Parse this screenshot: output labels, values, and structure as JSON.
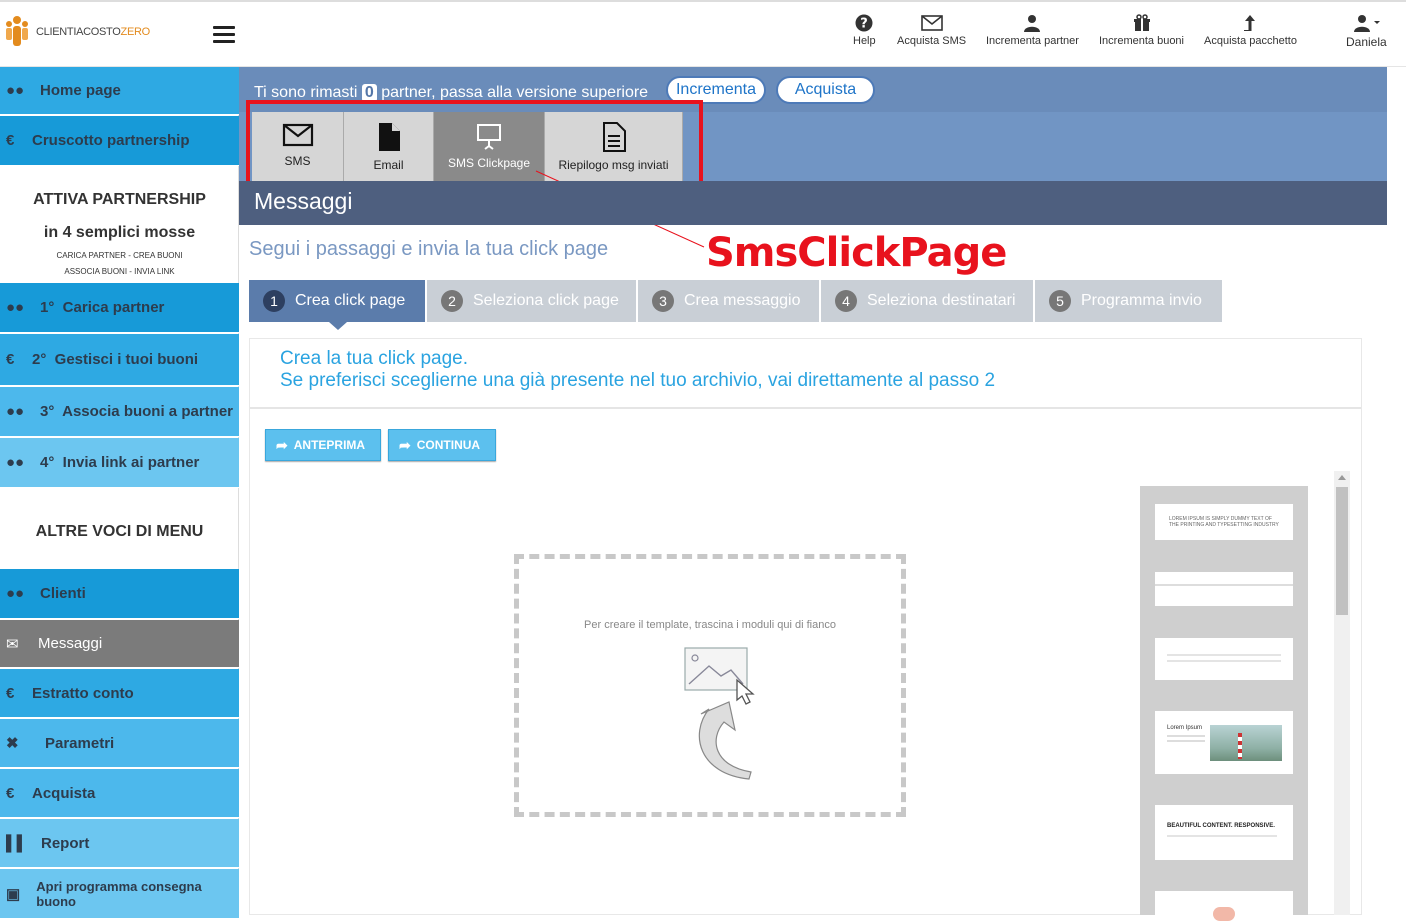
{
  "brand": {
    "part1": "CLIENTIACOSTO",
    "part2": "ZERO"
  },
  "topnav": [
    {
      "label": "Help",
      "icon": "help-icon"
    },
    {
      "label": "Acquista SMS",
      "icon": "envelope-icon"
    },
    {
      "label": "Incrementa partner",
      "icon": "user-icon"
    },
    {
      "label": "Incrementa buoni",
      "icon": "gift-icon"
    },
    {
      "label": "Acquista pacchetto",
      "icon": "arrow-up-icon"
    },
    {
      "label": "Daniela",
      "icon": "user-dropdown-icon"
    }
  ],
  "sidebar": {
    "home": "Home page",
    "cruscotto": "Cruscotto partnership",
    "attiva_title": "ATTIVA PARTNERSHIP",
    "attiva_sub": "in 4 semplici mosse",
    "attiva_line1": "CARICA PARTNER - CREA BUONI",
    "attiva_line2": "ASSOCIA BUONI - INVIA LINK",
    "step1": "1°  Carica partner",
    "step2": "2°  Gestisci i tuoi buoni",
    "step3": "3°  Associa buoni a partner",
    "step4": "4°  Invia link ai partner",
    "altre_title": "ALTRE VOCI DI MENU",
    "clienti": "Clienti",
    "messaggi": "Messaggi",
    "estratto": "Estratto conto",
    "parametri": "Parametri",
    "acquista": "Acquista",
    "report": "Report",
    "apri": "Apri programma consegna buono",
    "euro": "€"
  },
  "notice": {
    "before": "Ti sono rimasti",
    "count": "0",
    "after": "partner, passa alla versione superiore"
  },
  "notice_buttons": {
    "incrementa": "Incrementa",
    "acquista": "Acquista"
  },
  "message_tabs": [
    {
      "label": "SMS"
    },
    {
      "label": "Email"
    },
    {
      "label": "SMS Clickpage"
    },
    {
      "label": "Riepilogo msg inviati"
    }
  ],
  "section_title": "Messaggi",
  "annotation": "SmsClickPage",
  "subtitle": "Segui i passaggi e invia la tua click page",
  "steps": [
    {
      "num": "1",
      "label": "Crea click page"
    },
    {
      "num": "2",
      "label": "Seleziona click page"
    },
    {
      "num": "3",
      "label": "Crea messaggio"
    },
    {
      "num": "4",
      "label": "Seleziona destinatari"
    },
    {
      "num": "5",
      "label": "Programma invio"
    }
  ],
  "intro": {
    "line1": "Crea la tua click page.",
    "line2": "Se preferisci sceglierne una già presente nel tuo archivio, vai direttamente al passo 2"
  },
  "actions": {
    "preview": "ANTEPRIMA",
    "continue": "CONTINUA"
  },
  "dropzone_text": "Per creare il template, trascina i moduli qui di fianco",
  "modules": {
    "m1": "LOREM IPSUM IS SIMPLY DUMMY TEXT OF THE PRINTING AND TYPESETTING INDUSTRY",
    "m4_title": "Lorem Ipsum",
    "m5_title": "BEAUTIFUL CONTENT. RESPONSIVE."
  },
  "colors": {
    "accent": "#179ad8",
    "highlight": "#e8121d",
    "band": "#7195c4"
  }
}
